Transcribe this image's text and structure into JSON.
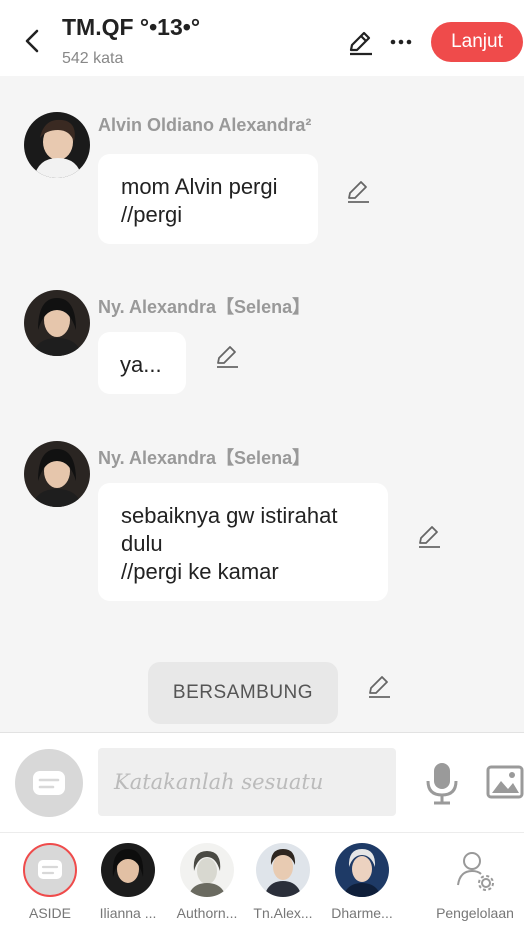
{
  "header": {
    "title": "TM.QF °•13•°",
    "subtitle": "542 kata",
    "next_label": "Lanjut"
  },
  "messages": [
    {
      "name": "Alvin Oldiano Alexandra²",
      "text_line1": "mom Alvin pergi",
      "text_line2": "//pergi"
    },
    {
      "name": "Ny. Alexandra【Selena】",
      "text_line1": "ya..."
    },
    {
      "name": "Ny. Alexandra【Selena】",
      "text_line1": "sebaiknya gw istirahat",
      "text_line2": "dulu",
      "text_line3": "//pergi ke kamar"
    }
  ],
  "continuation_label": "BERSAMBUNG",
  "input": {
    "placeholder": "Katakanlah sesuatu"
  },
  "tabs": [
    {
      "label": "ASIDE"
    },
    {
      "label": "Ilianna ..."
    },
    {
      "label": "Authorn..."
    },
    {
      "label": "Tn.Alex..."
    },
    {
      "label": "Dharme..."
    },
    {
      "label": "Pengelolaan"
    }
  ],
  "colors": {
    "accent": "#ef4b4b",
    "background": "#f5f5f5",
    "bubble": "#ffffff"
  },
  "icons": [
    "back-arrow-icon",
    "pencil-icon",
    "more-icon",
    "chat-bubble-icon",
    "microphone-icon",
    "image-icon",
    "user-settings-icon"
  ]
}
